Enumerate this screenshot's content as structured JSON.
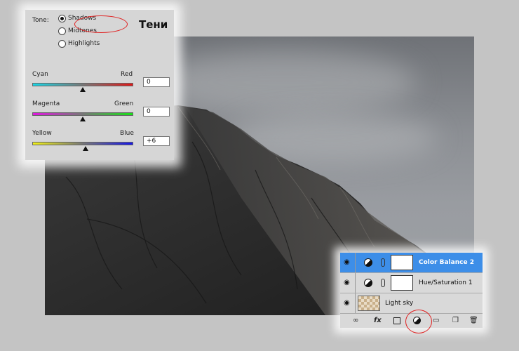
{
  "color_balance": {
    "tone_label": "Tone:",
    "tones": [
      {
        "label": "Shadows",
        "selected": true
      },
      {
        "label": "Midtones",
        "selected": false
      },
      {
        "label": "Highlights",
        "selected": false
      }
    ],
    "annotation": "Тени",
    "sliders": [
      {
        "left": "Cyan",
        "right": "Red",
        "value": "0",
        "colors": [
          "#18d6e6",
          "#e01818"
        ],
        "level": 0
      },
      {
        "left": "Magenta",
        "right": "Green",
        "value": "0",
        "colors": [
          "#e018e0",
          "#18e018"
        ],
        "level": 0
      },
      {
        "left": "Yellow",
        "right": "Blue",
        "value": "+6",
        "colors": [
          "#f0f018",
          "#1818e8"
        ],
        "level": 6
      }
    ]
  },
  "layers": [
    {
      "name": "Color Balance 2",
      "selected": true,
      "type": "adjustment"
    },
    {
      "name": "Hue/Saturation 1",
      "selected": false,
      "type": "adjustment"
    },
    {
      "name": "Light sky",
      "selected": false,
      "type": "image"
    }
  ],
  "layers_toolbar": {
    "link": "link-icon",
    "fx": "fx",
    "mask": "mask-icon",
    "adjustment": "adjustment-layer-icon",
    "group": "folder-icon",
    "new_layer": "new-layer-icon",
    "delete": "trash-icon"
  },
  "colors": {
    "highlight_oval": "#e02020",
    "selected_layer": "#3d8ee8"
  }
}
